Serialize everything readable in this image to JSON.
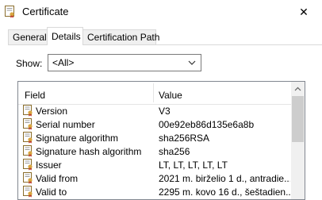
{
  "window": {
    "title": "Certificate",
    "close_glyph": "✕"
  },
  "tabs": [
    {
      "label": "General"
    },
    {
      "label": "Details"
    },
    {
      "label": "Certification Path"
    }
  ],
  "active_tab": "Details",
  "show": {
    "label": "Show:",
    "selected": "<All>"
  },
  "columns": {
    "field": "Field",
    "value": "Value"
  },
  "rows": [
    {
      "field": "Version",
      "value": "V3"
    },
    {
      "field": "Serial number",
      "value": "00e92eb86d135e6a8b"
    },
    {
      "field": "Signature algorithm",
      "value": "sha256RSA"
    },
    {
      "field": "Signature hash algorithm",
      "value": "sha256"
    },
    {
      "field": "Issuer",
      "value": "LT, LT, LT, LT, LT"
    },
    {
      "field": "Valid from",
      "value": "2021 m. birželio 1 d., antradie..."
    },
    {
      "field": "Valid to",
      "value": "2295 m. kovo 16 d., šeštadien..."
    }
  ],
  "icons": {
    "window": "certificate-icon",
    "row": "certificate-field-icon"
  },
  "colors": {
    "icon_gold": "#d9a640",
    "icon_ribbon": "#c0392b",
    "border": "#828790"
  }
}
